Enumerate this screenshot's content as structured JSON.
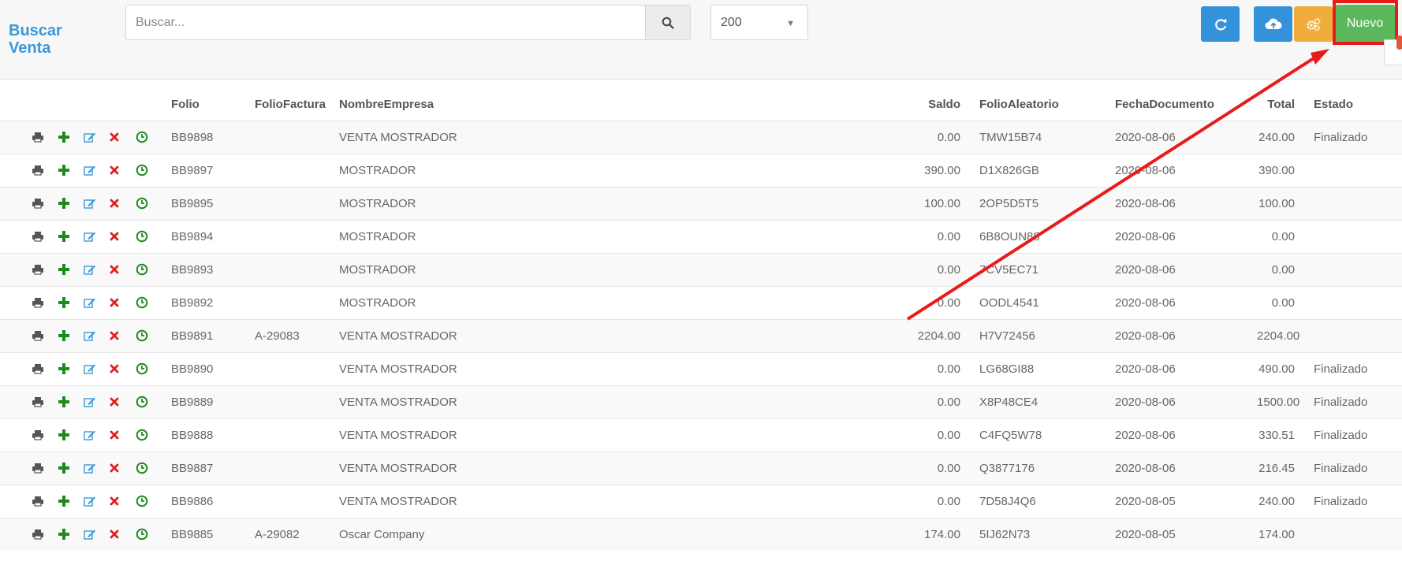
{
  "page_title": "Buscar Venta",
  "search": {
    "placeholder": "Buscar..."
  },
  "page_size": {
    "selected": "200"
  },
  "toolbar": {
    "new_label": "Nuevo"
  },
  "table": {
    "columns": [
      "Folio",
      "FolioFactura",
      "NombreEmpresa",
      "Saldo",
      "FolioAleatorio",
      "FechaDocumento",
      "Total",
      "Estado"
    ],
    "rows": [
      [
        "BB9898",
        "",
        "VENTA MOSTRADOR",
        "0.00",
        "TMW15B74",
        "2020-08-06",
        "240.00",
        "Finalizado"
      ],
      [
        "BB9897",
        "",
        "MOSTRADOR",
        "390.00",
        "D1X826GB",
        "2020-08-06",
        "390.00",
        ""
      ],
      [
        "BB9895",
        "",
        "MOSTRADOR",
        "100.00",
        "2OP5D5T5",
        "2020-08-06",
        "100.00",
        ""
      ],
      [
        "BB9894",
        "",
        "MOSTRADOR",
        "0.00",
        "6B8OUN88",
        "2020-08-06",
        "0.00",
        ""
      ],
      [
        "BB9893",
        "",
        "MOSTRADOR",
        "0.00",
        "7CV5EC71",
        "2020-08-06",
        "0.00",
        ""
      ],
      [
        "BB9892",
        "",
        "MOSTRADOR",
        "0.00",
        "OODL4541",
        "2020-08-06",
        "0.00",
        ""
      ],
      [
        "BB9891",
        "A-29083",
        "VENTA MOSTRADOR",
        "2204.00",
        "H7V72456",
        "2020-08-06",
        "2204.00",
        ""
      ],
      [
        "BB9890",
        "",
        "VENTA MOSTRADOR",
        "0.00",
        "LG68GI88",
        "2020-08-06",
        "490.00",
        "Finalizado"
      ],
      [
        "BB9889",
        "",
        "VENTA MOSTRADOR",
        "0.00",
        "X8P48CE4",
        "2020-08-06",
        "1500.00",
        "Finalizado"
      ],
      [
        "BB9888",
        "",
        "VENTA MOSTRADOR",
        "0.00",
        "C4FQ5W78",
        "2020-08-06",
        "330.51",
        "Finalizado"
      ],
      [
        "BB9887",
        "",
        "VENTA MOSTRADOR",
        "0.00",
        "Q3877176",
        "2020-08-06",
        "216.45",
        "Finalizado"
      ],
      [
        "BB9886",
        "",
        "VENTA MOSTRADOR",
        "0.00",
        "7D58J4Q6",
        "2020-08-05",
        "240.00",
        "Finalizado"
      ],
      [
        "BB9885",
        "A-29082",
        "Oscar Company",
        "174.00",
        "5IJ62N73",
        "2020-08-05",
        "174.00",
        ""
      ]
    ]
  },
  "colors": {
    "title": "#3a9ad9",
    "primary": "#3492db",
    "warning": "#f0ad3b",
    "success": "#5cb85c",
    "annotation": "#e81b1b"
  },
  "icons": [
    "search-icon",
    "refresh-icon",
    "cloud-upload-icon",
    "gears-icon",
    "print-icon",
    "add-icon",
    "edit-icon",
    "delete-icon",
    "clock-icon"
  ]
}
